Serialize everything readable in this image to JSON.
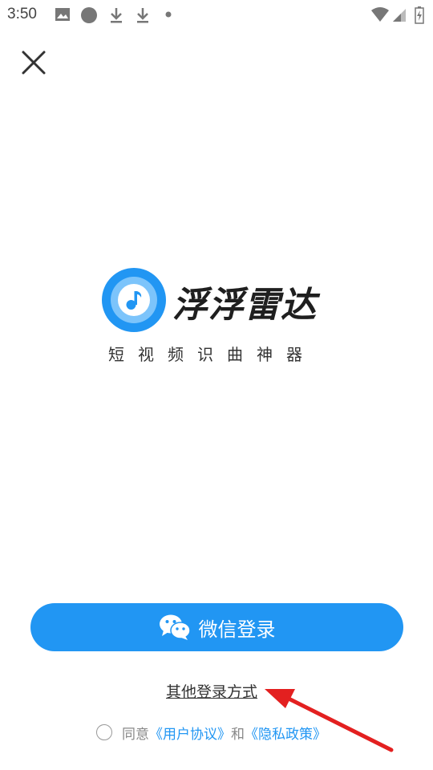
{
  "status_bar": {
    "time": "3:50",
    "icons": [
      "image-icon",
      "circle-icon",
      "download-icon",
      "download-icon",
      "dot-icon",
      "wifi-icon",
      "signal-icon",
      "battery-icon"
    ]
  },
  "close_icon": "close-icon",
  "app": {
    "name": "浮浮雷达",
    "tagline": "短视频识曲神器",
    "logo_icon": "music-note-icon",
    "brand_color": "#2196f3"
  },
  "wechat_login": {
    "label": "微信登录",
    "icon": "wechat-icon"
  },
  "other_login": {
    "label": "其他登录方式"
  },
  "agreement": {
    "agree_text": "同意",
    "user_agreement": "《用户协议》",
    "and_text": "和",
    "privacy_policy": "《隐私政策》"
  },
  "annotation_arrow_color": "#e32020"
}
